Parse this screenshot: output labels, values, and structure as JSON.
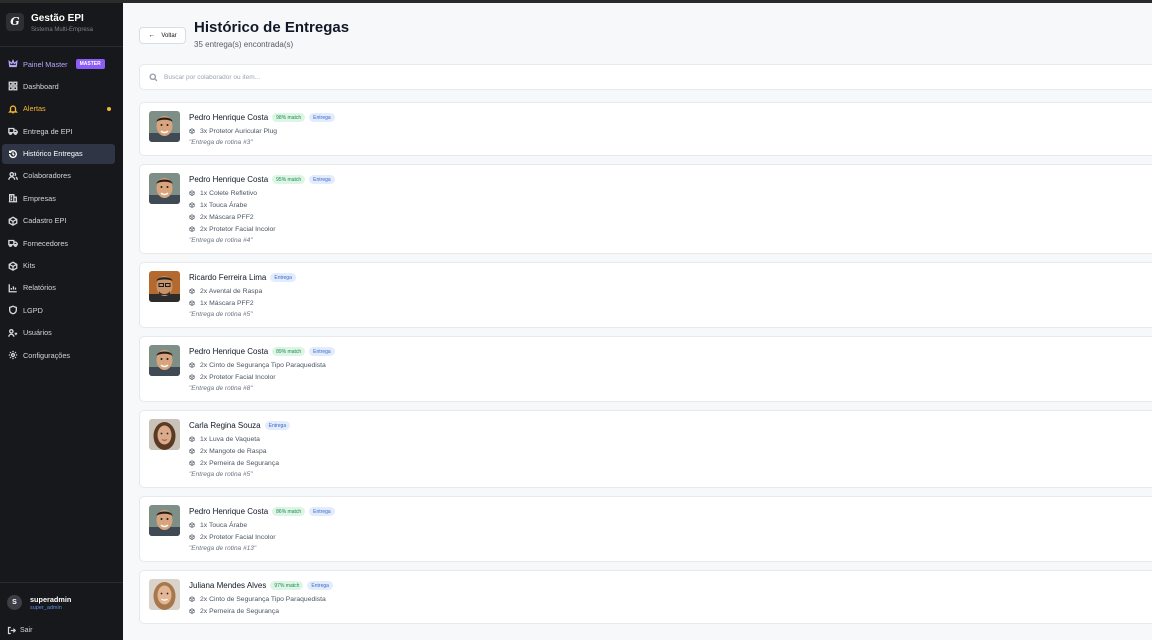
{
  "app": {
    "logo_letter": "G",
    "name": "Gestão EPI",
    "subtitle": "Sistema Multi-Empresa"
  },
  "nav": [
    {
      "label": "Painel Master",
      "icon": "crown-icon",
      "badge": "MASTER",
      "state": "master"
    },
    {
      "label": "Dashboard",
      "icon": "grid-icon"
    },
    {
      "label": "Alertas",
      "icon": "bell-icon",
      "state": "alert",
      "dot": true
    },
    {
      "label": "Entrega de EPI",
      "icon": "truck-icon"
    },
    {
      "label": "Histórico Entregas",
      "icon": "history-icon",
      "state": "active"
    },
    {
      "label": "Colaboradores",
      "icon": "users-icon"
    },
    {
      "label": "Empresas",
      "icon": "building-icon"
    },
    {
      "label": "Cadastro EPI",
      "icon": "box-icon"
    },
    {
      "label": "Fornecedores",
      "icon": "supplier-icon"
    },
    {
      "label": "Kits",
      "icon": "cube-icon"
    },
    {
      "label": "Relatórios",
      "icon": "chart-icon"
    },
    {
      "label": "LGPD",
      "icon": "shield-icon"
    },
    {
      "label": "Usuários",
      "icon": "user-key-icon"
    },
    {
      "label": "Configurações",
      "icon": "gear-icon"
    }
  ],
  "user": {
    "initial": "S",
    "name": "superadmin",
    "role": "super_admin"
  },
  "logout_label": "Sair",
  "header": {
    "back_label": "Voltar",
    "title": "Histórico de Entregas",
    "subtitle": "35 entrega(s) encontrada(s)"
  },
  "search": {
    "placeholder": "Buscar por colaborador ou item...",
    "value": ""
  },
  "deliveries": [
    {
      "name": "Pedro Henrique Costa",
      "match": "98% match",
      "type": "Entrega",
      "photo": "pedro",
      "items": [
        "3x Protetor Auricular Plug"
      ],
      "note": "\"Entrega de rotina #3\""
    },
    {
      "name": "Pedro Henrique Costa",
      "match": "95% match",
      "type": "Entrega",
      "photo": "pedro",
      "items": [
        "1x Colete Refletivo",
        "1x Touca Árabe",
        "2x Máscara PFF2",
        "2x Protetor Facial Incolor"
      ],
      "note": "\"Entrega de rotina #4\""
    },
    {
      "name": "Ricardo Ferreira Lima",
      "match": "",
      "type": "Entrega",
      "photo": "ricardo",
      "items": [
        "2x Avental de Raspa",
        "1x Máscara PFF2"
      ],
      "note": "\"Entrega de rotina #5\""
    },
    {
      "name": "Pedro Henrique Costa",
      "match": "89% match",
      "type": "Entrega",
      "photo": "pedro",
      "items": [
        "2x Cinto de Segurança Tipo Paraquedista",
        "2x Protetor Facial Incolor"
      ],
      "note": "\"Entrega de rotina #8\""
    },
    {
      "name": "Carla Regina Souza",
      "match": "",
      "type": "Entrega",
      "photo": "carla",
      "items": [
        "1x Luva de Vaqueta",
        "2x Mangote de Raspa",
        "2x Perneira de Segurança"
      ],
      "note": "\"Entrega de rotina #5\""
    },
    {
      "name": "Pedro Henrique Costa",
      "match": "86% match",
      "type": "Entrega",
      "photo": "pedro",
      "items": [
        "1x Touca Árabe",
        "2x Protetor Facial Incolor"
      ],
      "note": "\"Entrega de rotina #13\""
    },
    {
      "name": "Juliana Mendes Alves",
      "match": "97% match",
      "type": "Entrega",
      "photo": "juliana",
      "items": [
        "2x Cinto de Segurança Tipo Paraquedista",
        "2x Perneira de Segurança"
      ],
      "note": ""
    }
  ]
}
